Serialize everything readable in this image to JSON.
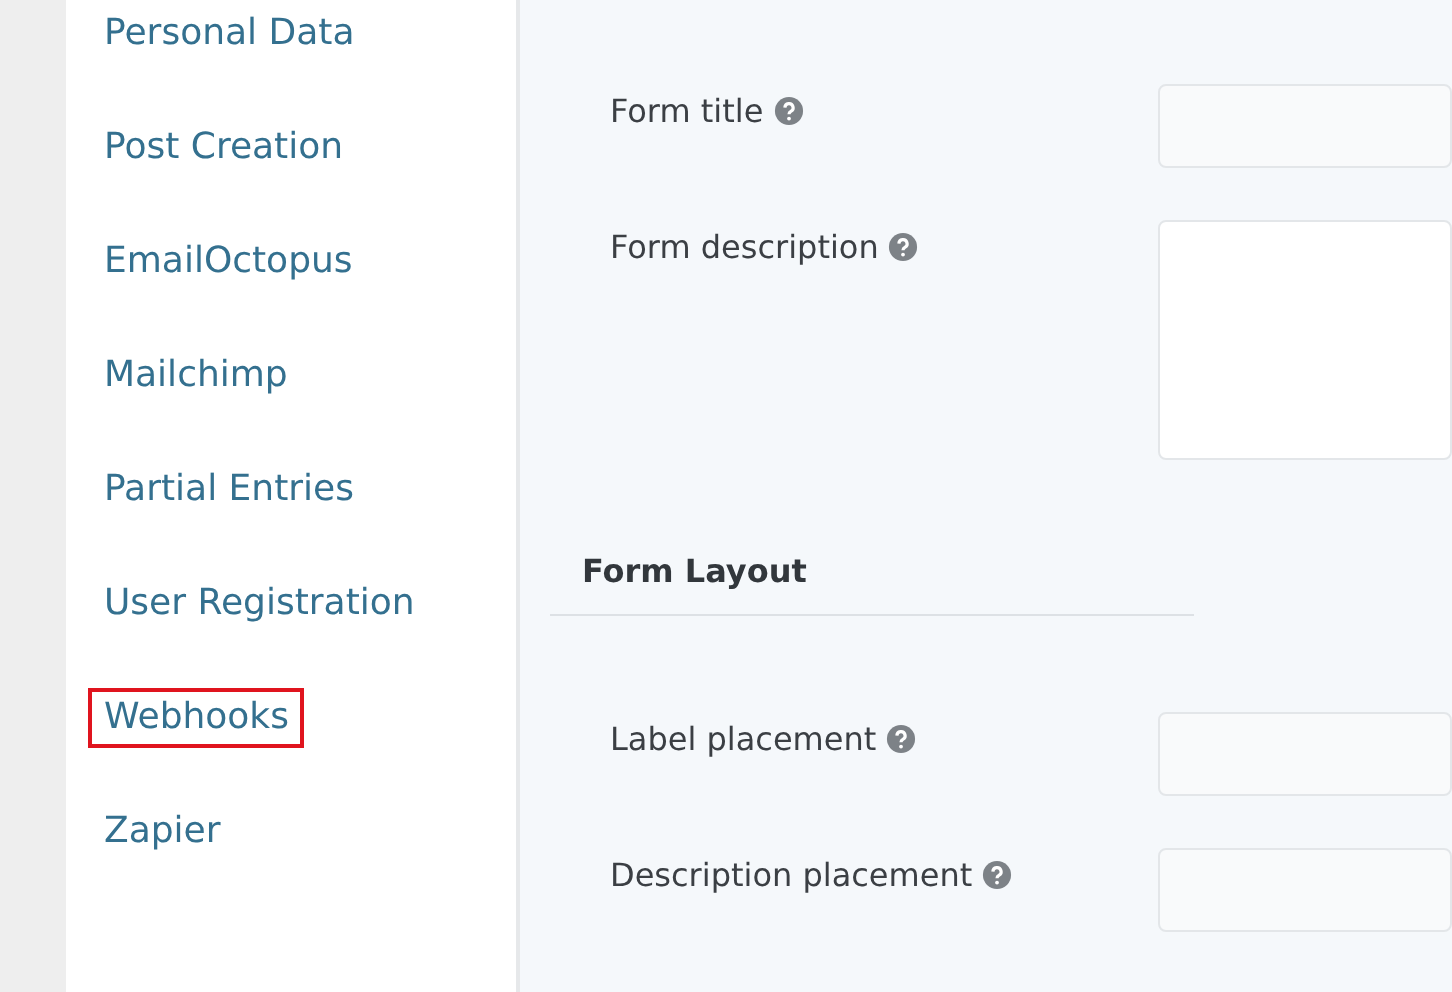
{
  "sidebar": {
    "items": [
      {
        "label": "Personal Data",
        "highlighted": false
      },
      {
        "label": "Post Creation",
        "highlighted": false
      },
      {
        "label": "EmailOctopus",
        "highlighted": false
      },
      {
        "label": "Mailchimp",
        "highlighted": false
      },
      {
        "label": "Partial Entries",
        "highlighted": false
      },
      {
        "label": "User Registration",
        "highlighted": false
      },
      {
        "label": "Webhooks",
        "highlighted": true
      },
      {
        "label": "Zapier",
        "highlighted": false
      }
    ]
  },
  "settings": [
    {
      "kind": "field",
      "label": "Form title"
    },
    {
      "kind": "textarea",
      "label": "Form description"
    },
    {
      "kind": "heading",
      "label": "Form Layout"
    },
    {
      "kind": "field",
      "label": "Label placement"
    },
    {
      "kind": "field",
      "label": "Description placement"
    }
  ]
}
